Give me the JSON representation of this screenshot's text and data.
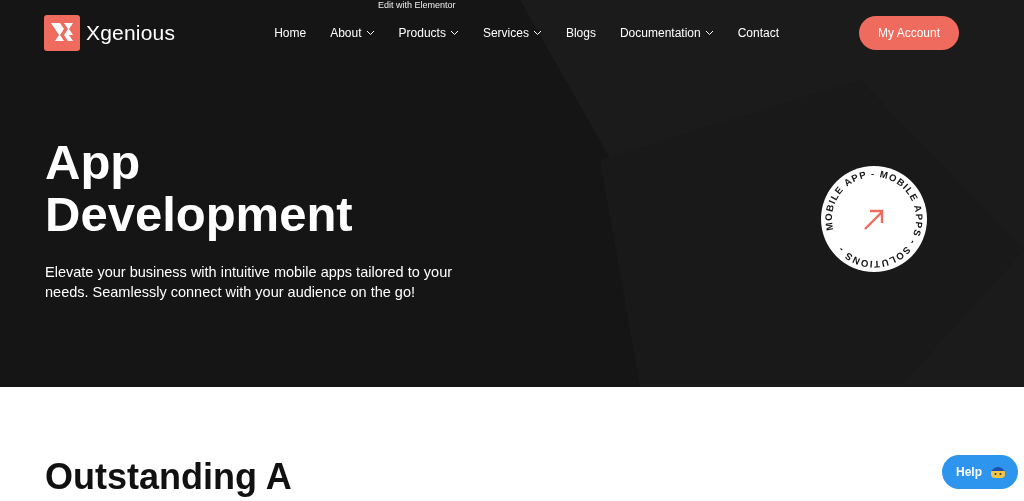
{
  "editor_label": "Edit with Elementor",
  "header": {
    "brand": "Xgenious",
    "nav": [
      {
        "label": "Home",
        "dropdown": false
      },
      {
        "label": "About",
        "dropdown": true
      },
      {
        "label": "Products",
        "dropdown": true
      },
      {
        "label": "Services",
        "dropdown": true
      },
      {
        "label": "Blogs",
        "dropdown": false
      },
      {
        "label": "Documentation",
        "dropdown": true
      },
      {
        "label": "Contact",
        "dropdown": false
      }
    ],
    "account_button": "My Account"
  },
  "hero": {
    "title_lines": [
      "App",
      "Development"
    ],
    "description": "Elevate your business with intuitive mobile apps tailored to your needs. Seamlessly connect with your audience on the go!",
    "badge_text": "MOBILE APP - MOBILE APPS - SOLUTIONS - "
  },
  "section": {
    "heading": "Outstanding A"
  },
  "help_button": "Help"
}
